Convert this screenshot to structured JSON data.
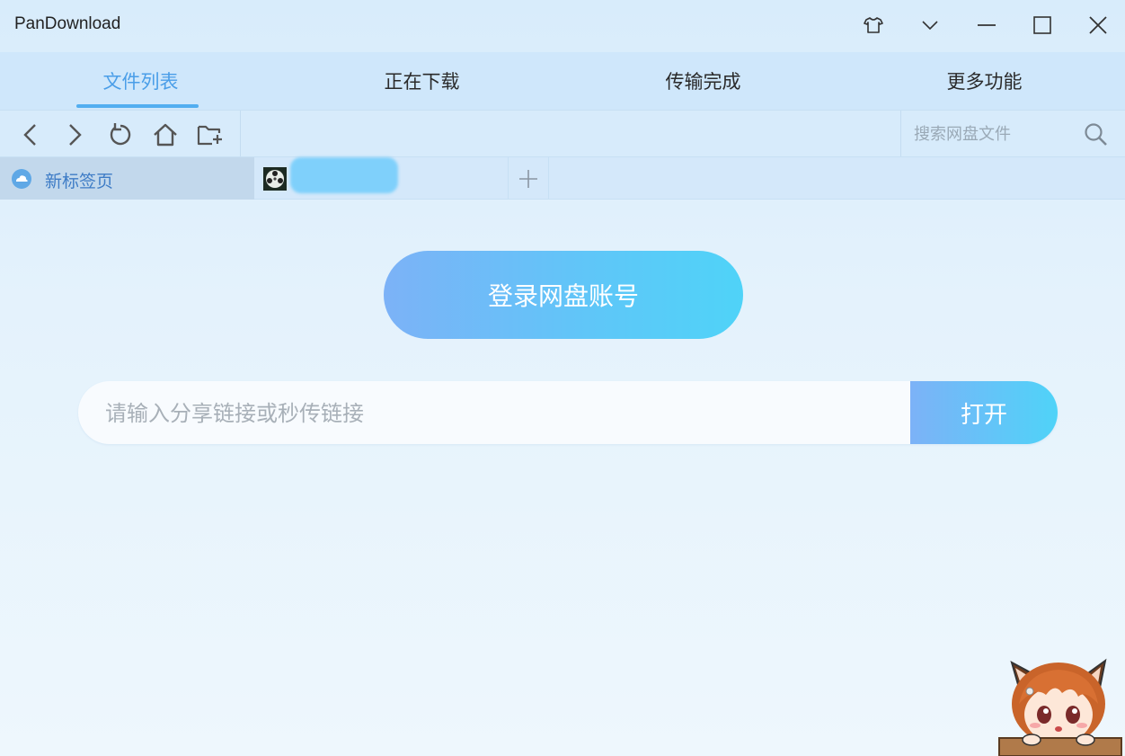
{
  "window": {
    "title": "PanDownload"
  },
  "titlebar": {
    "buttons": [
      "skin-icon",
      "dropdown-icon",
      "minimize-icon",
      "maximize-icon",
      "close-icon"
    ]
  },
  "nav": {
    "tabs": [
      {
        "label": "文件列表",
        "active": true
      },
      {
        "label": "正在下载",
        "active": false
      },
      {
        "label": "传输完成",
        "active": false
      },
      {
        "label": "更多功能",
        "active": false
      }
    ]
  },
  "toolbar": {
    "icons": [
      "back-arrow-icon",
      "forward-arrow-icon",
      "refresh-icon",
      "home-icon",
      "new-folder-icon"
    ],
    "search_placeholder": "搜索网盘文件"
  },
  "file_tabs": {
    "active_label": "新标签页",
    "add_label": "+"
  },
  "main": {
    "login_label": "登录网盘账号",
    "share_placeholder": "请输入分享链接或秒传链接",
    "open_label": "打开"
  },
  "colors": {
    "accent": "#52aef0",
    "active_tab_text": "#4a9ee8",
    "button_gradient_start": "#7cb2f7",
    "button_gradient_end": "#4fd3f8"
  }
}
